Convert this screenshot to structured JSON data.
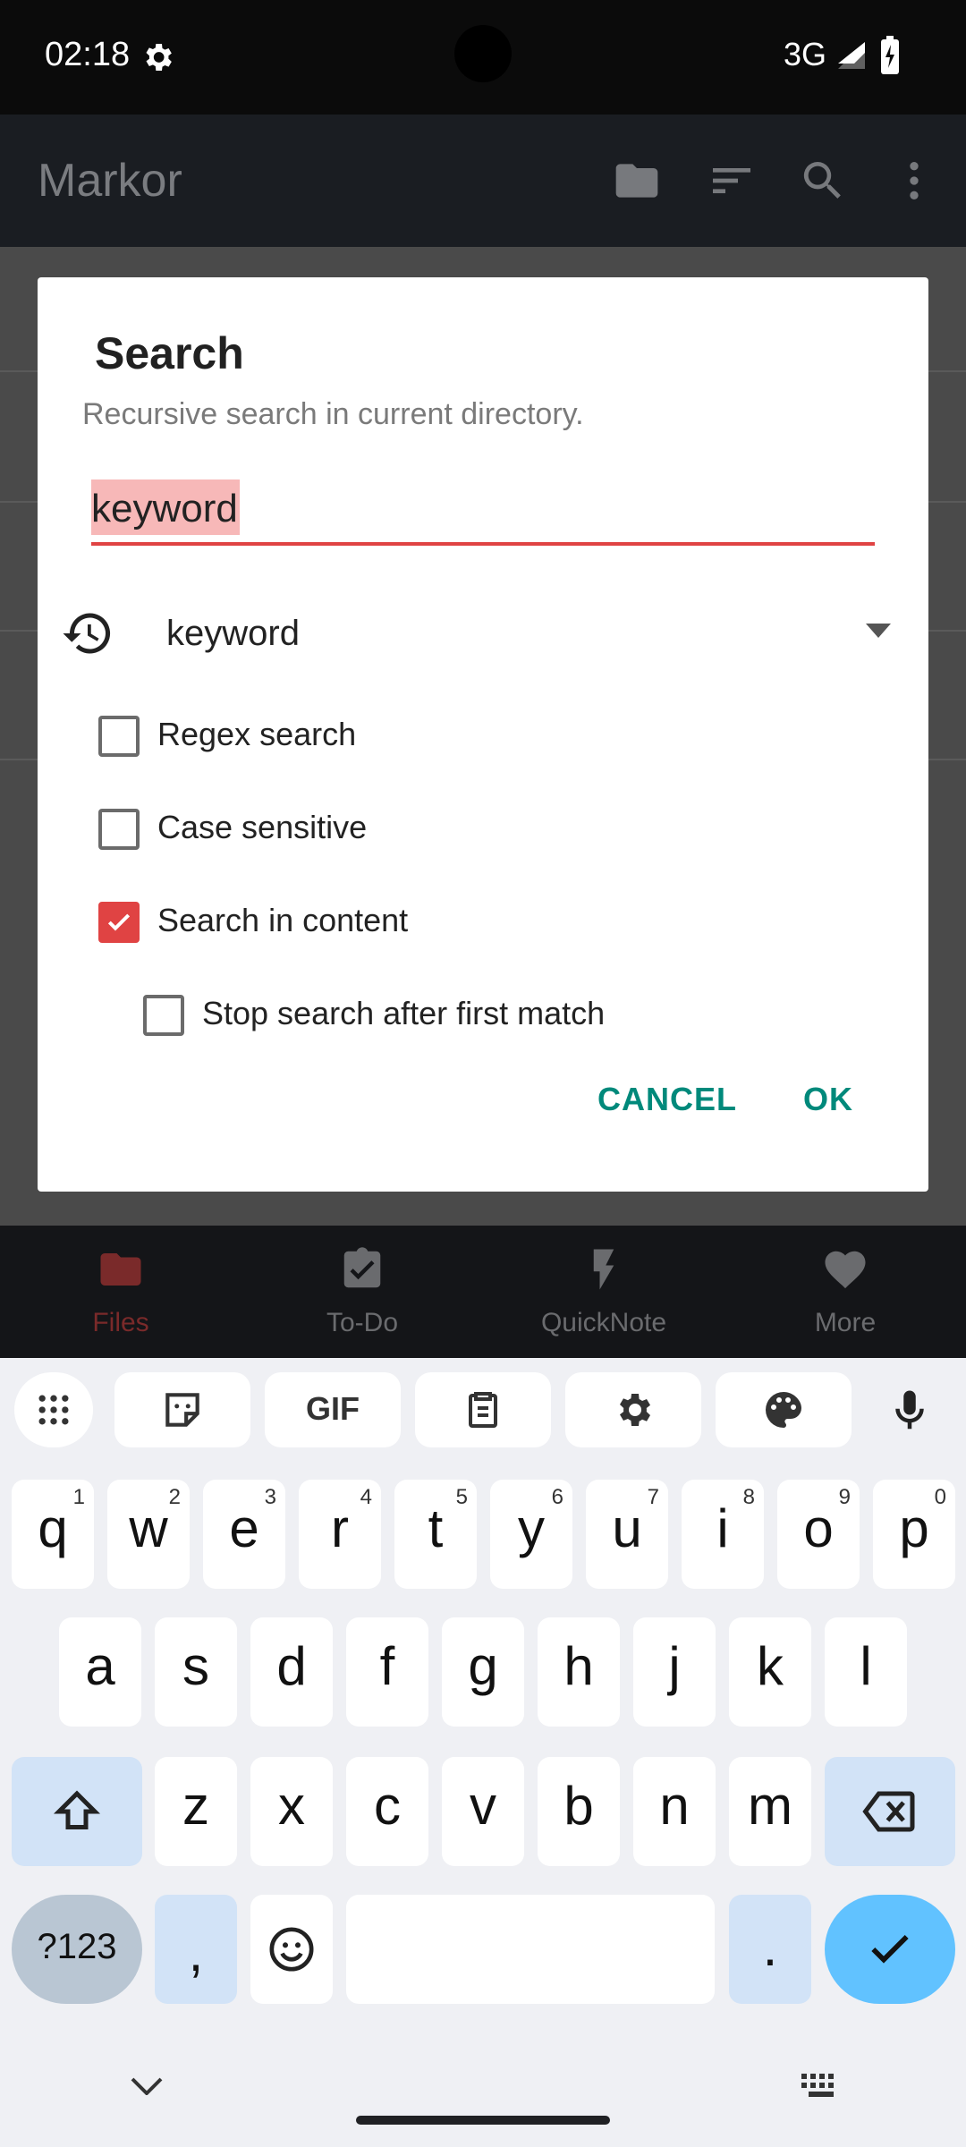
{
  "status_bar": {
    "time": "02:18",
    "network": "3G"
  },
  "app_bar": {
    "title": "Markor"
  },
  "bottom_nav": {
    "items": [
      {
        "label": "Files",
        "active": true
      },
      {
        "label": "To-Do"
      },
      {
        "label": "QuickNote"
      },
      {
        "label": "More"
      }
    ]
  },
  "dialog": {
    "title": "Search",
    "subtitle": "Recursive search in current directory.",
    "input_value": "keyword",
    "history_value": "keyword",
    "options": [
      {
        "label": "Regex search",
        "checked": false
      },
      {
        "label": "Case sensitive",
        "checked": false
      },
      {
        "label": "Search in content",
        "checked": true
      },
      {
        "label": "Stop search after first match",
        "checked": false
      }
    ],
    "cancel_label": "CANCEL",
    "ok_label": "OK"
  },
  "keyboard": {
    "row1": [
      {
        "k": "q",
        "h": "1"
      },
      {
        "k": "w",
        "h": "2"
      },
      {
        "k": "e",
        "h": "3"
      },
      {
        "k": "r",
        "h": "4"
      },
      {
        "k": "t",
        "h": "5"
      },
      {
        "k": "y",
        "h": "6"
      },
      {
        "k": "u",
        "h": "7"
      },
      {
        "k": "i",
        "h": "8"
      },
      {
        "k": "o",
        "h": "9"
      },
      {
        "k": "p",
        "h": "0"
      }
    ],
    "row2": [
      "a",
      "s",
      "d",
      "f",
      "g",
      "h",
      "j",
      "k",
      "l"
    ],
    "row3": [
      "z",
      "x",
      "c",
      "v",
      "b",
      "n",
      "m"
    ],
    "sym_label": "?123",
    "comma": ",",
    "period": ".",
    "gif_label": "GIF"
  },
  "colors": {
    "accent": "#e04343",
    "button_text": "#00897b",
    "enter_key": "#61c2ff"
  }
}
